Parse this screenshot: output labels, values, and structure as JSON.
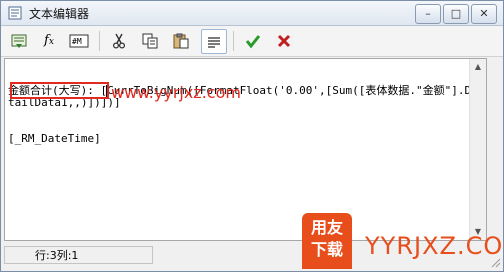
{
  "window": {
    "title": "文本编辑器",
    "controls": {
      "minimize": "–",
      "restore": "□",
      "close": "✕"
    }
  },
  "toolbar": {
    "buttons": [
      {
        "name": "insert-field-button",
        "icon": "insert-field-icon",
        "glyph": "▦"
      },
      {
        "name": "insert-function-button",
        "icon": "fx-icon",
        "glyph": "fx"
      },
      {
        "name": "insert-var-button",
        "icon": "var-icon",
        "glyph": "#a"
      },
      {
        "name": "cut-button",
        "icon": "scissors-icon",
        "glyph": "✂"
      },
      {
        "name": "copy-button",
        "icon": "copy-icon",
        "glyph": "⧉"
      },
      {
        "name": "paste-button",
        "icon": "paste-icon",
        "glyph": "📋"
      },
      {
        "name": "align-button",
        "icon": "align-left-icon",
        "glyph": "≡"
      },
      {
        "name": "confirm-button",
        "icon": "check-icon",
        "glyph": "✔"
      },
      {
        "name": "cancel-button",
        "icon": "x-icon",
        "glyph": "✖"
      }
    ]
  },
  "editor": {
    "line1": "金额合计(大写): [CurrToBigNum([FormatFloat('0.00',[Sum([表体数据.\"金额\"].DetailData1,,)])])]",
    "line2": "[_RM_DateTime]"
  },
  "watermark": {
    "url": "www.yyrjxz.com",
    "badge_line1": "用友",
    "badge_line2": "下载",
    "brand": "YYRJXZ.COM"
  },
  "status": {
    "position": "行:3列:1"
  },
  "colors": {
    "accent_red": "#e22a20",
    "brand_orange": "#e74e1c",
    "confirm_green": "#2a9a2a",
    "cancel_red": "#c02020"
  }
}
